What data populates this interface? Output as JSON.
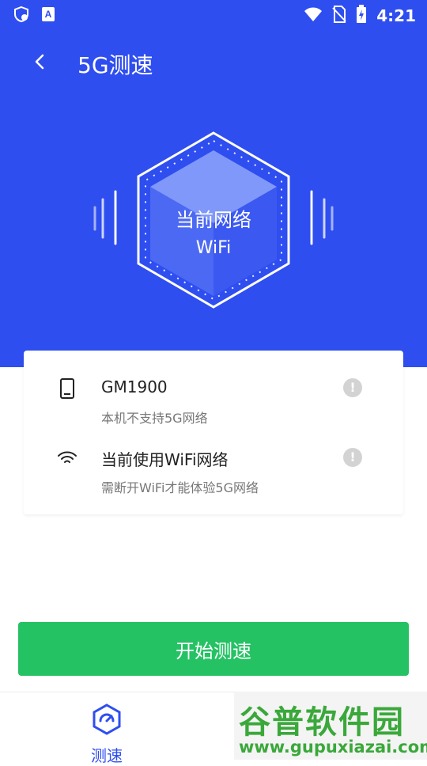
{
  "status_bar": {
    "time": "4:21",
    "icons": [
      "shield-icon",
      "a-badge-icon",
      "wifi-icon",
      "no-sim-icon",
      "battery-charging-icon"
    ]
  },
  "header": {
    "title": "5G测速",
    "back_icon": "chevron-left-icon"
  },
  "hero": {
    "line1": "当前网络",
    "line2": "WiFi"
  },
  "card": {
    "rows": [
      {
        "icon": "phone-icon",
        "title": "GM1900",
        "subtitle": "本机不支持5G网络",
        "info_icon": "info-icon"
      },
      {
        "icon": "wifi-icon",
        "title": "当前使用WiFi网络",
        "subtitle": "需断开WiFi才能体验5G网络",
        "info_icon": "info-icon"
      }
    ]
  },
  "start_button": {
    "label": "开始测速"
  },
  "bottom_nav": {
    "items": [
      {
        "label": "测速",
        "icon": "speedometer-icon",
        "active": true
      }
    ]
  },
  "watermark": {
    "title": "谷普软件园",
    "url": "www.gupuxiazai.com"
  },
  "colors": {
    "primary": "#2f4ef0",
    "accent_green": "#25c264",
    "info_gray": "#d3d3d3"
  }
}
